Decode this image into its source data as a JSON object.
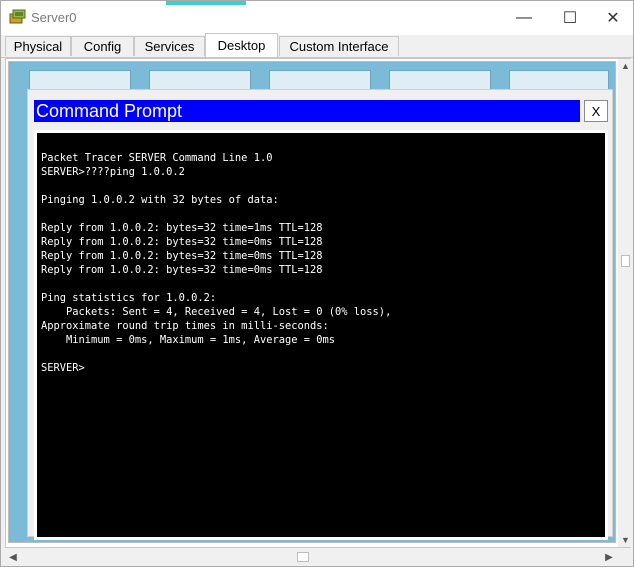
{
  "window": {
    "title": "Server0",
    "icon": "packet-tracer-server-icon",
    "controls": {
      "minimize": "—",
      "maximize": "☐",
      "close": "✕"
    }
  },
  "tabs": [
    {
      "label": "Physical",
      "active": false
    },
    {
      "label": "Config",
      "active": false
    },
    {
      "label": "Services",
      "active": false
    },
    {
      "label": "Desktop",
      "active": true
    },
    {
      "label": "Custom Interface",
      "active": false
    }
  ],
  "command_prompt": {
    "title": "Command Prompt",
    "close_label": "X",
    "output": "Packet Tracer SERVER Command Line 1.0\nSERVER>????ping 1.0.0.2\n\nPinging 1.0.0.2 with 32 bytes of data:\n\nReply from 1.0.0.2: bytes=32 time=1ms TTL=128\nReply from 1.0.0.2: bytes=32 time=0ms TTL=128\nReply from 1.0.0.2: bytes=32 time=0ms TTL=128\nReply from 1.0.0.2: bytes=32 time=0ms TTL=128\n\nPing statistics for 1.0.0.2:\n    Packets: Sent = 4, Received = 4, Lost = 0 (0% loss),\nApproximate round trip times in milli-seconds:\n    Minimum = 0ms, Maximum = 1ms, Average = 0ms\n\nSERVER>"
  },
  "colors": {
    "title_bar_blue": "#0000ff",
    "desktop_background": "#7bbbd7",
    "terminal_background": "#000000",
    "terminal_text": "#ffffff"
  }
}
